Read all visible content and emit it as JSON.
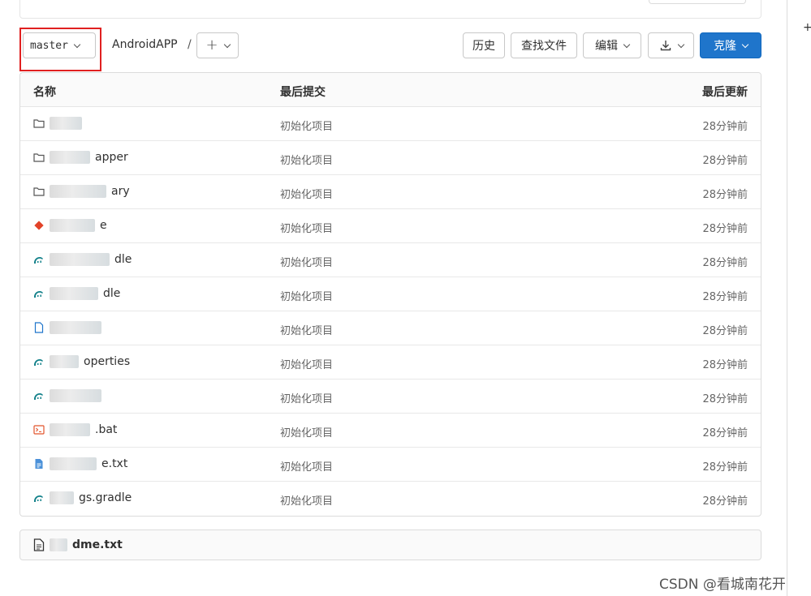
{
  "toolbar": {
    "branch": "master",
    "project": "AndroidAPP",
    "separator": "/",
    "history_label": "历史",
    "find_file_label": "查找文件",
    "edit_label": "编辑",
    "clone_label": "克隆"
  },
  "table": {
    "headers": {
      "name": "名称",
      "last_commit": "最后提交",
      "last_update": "最后更新"
    },
    "rows": [
      {
        "icon": "folder-icon",
        "name_visible": "",
        "commit": "初始化项目",
        "updated": "28分钟前"
      },
      {
        "icon": "folder-icon",
        "name_visible": "apper",
        "commit": "初始化项目",
        "updated": "28分钟前"
      },
      {
        "icon": "folder-icon",
        "name_visible": "ary",
        "commit": "初始化项目",
        "updated": "28分钟前"
      },
      {
        "icon": "git-icon",
        "name_visible": "e",
        "commit": "初始化项目",
        "updated": "28分钟前"
      },
      {
        "icon": "gradle-icon",
        "name_visible": "dle",
        "commit": "初始化项目",
        "updated": "28分钟前"
      },
      {
        "icon": "gradle-icon",
        "name_visible": "dle",
        "commit": "初始化项目",
        "updated": "28分钟前"
      },
      {
        "icon": "file-icon",
        "name_visible": "",
        "commit": "初始化项目",
        "updated": "28分钟前"
      },
      {
        "icon": "gradle-icon",
        "name_visible": "operties",
        "commit": "初始化项目",
        "updated": "28分钟前"
      },
      {
        "icon": "gradle-icon",
        "name_visible": "",
        "commit": "初始化项目",
        "updated": "28分钟前"
      },
      {
        "icon": "terminal-icon",
        "name_visible": ".bat",
        "commit": "初始化项目",
        "updated": "28分钟前"
      },
      {
        "icon": "text-file-icon",
        "name_visible": "e.txt",
        "commit": "初始化项目",
        "updated": "28分钟前"
      },
      {
        "icon": "gradle-icon",
        "name_visible": "gs.gradle",
        "commit": "初始化项目",
        "updated": "28分钟前"
      }
    ]
  },
  "readme": {
    "name_visible": "dme.txt"
  },
  "watermark": "CSDN @看城南花开",
  "colors": {
    "primary": "#1f75cb",
    "highlight": "#e02020",
    "gradle": "#02303a",
    "git": "#e24329"
  }
}
